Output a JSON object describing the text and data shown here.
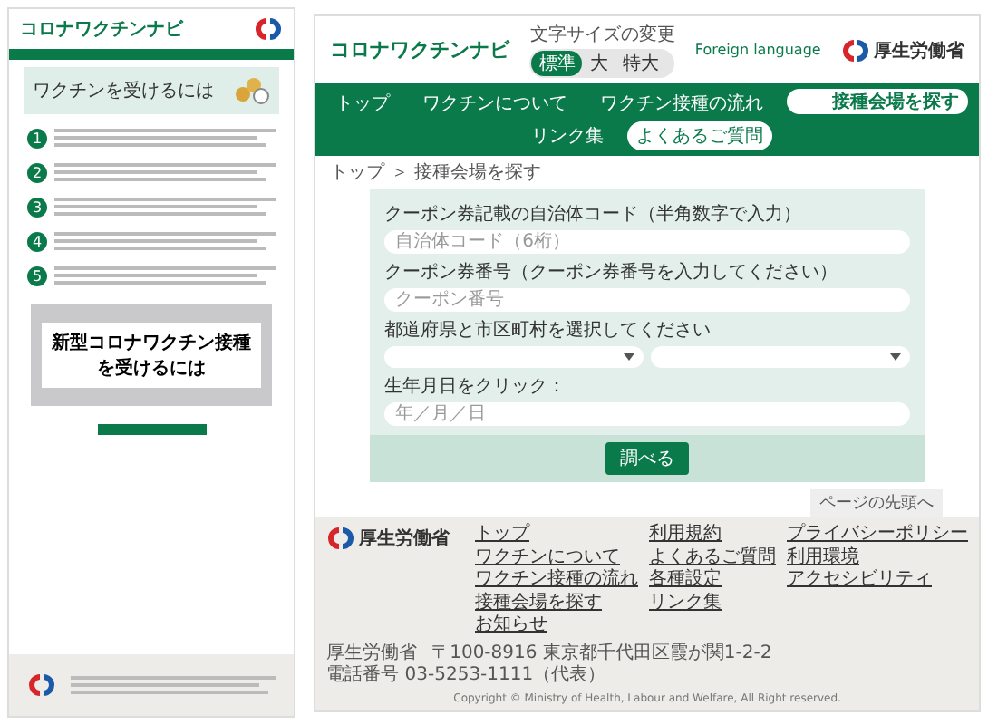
{
  "left_page": {
    "logo": "コロナワクチンナビ",
    "hero_title": "ワクチンを受けるには",
    "steps": [
      {
        "number": "1"
      },
      {
        "number": "2"
      },
      {
        "number": "3"
      },
      {
        "number": "4"
      },
      {
        "number": "5"
      }
    ],
    "video": {
      "caption": "新型コロナワクチン接種を受けるには"
    }
  },
  "right_page": {
    "header": {
      "logo": "コロナワクチンナビ",
      "font_size_label": "文字サイズの変更",
      "font_sizes": [
        {
          "label": "標準",
          "selected": true
        },
        {
          "label": "大",
          "selected": false
        },
        {
          "label": "特大",
          "selected": false
        }
      ],
      "language": "Foreign language",
      "ministry": "厚生労働省"
    },
    "nav": [
      {
        "label": "トップ",
        "kind": "link",
        "selected": false
      },
      {
        "label": "ワクチンについて",
        "kind": "link",
        "selected": false
      },
      {
        "label": "ワクチン接種の流れ",
        "kind": "link",
        "selected": false
      },
      {
        "label": "接種会場を探す",
        "kind": "link",
        "selected": true
      },
      {
        "label": "リンク集",
        "kind": "link",
        "selected": false
      },
      {
        "label": "よくあるご質問",
        "kind": "button",
        "selected": false
      }
    ],
    "breadcrumb": "トップ ＞ 接種会場を探す",
    "form": {
      "fields": [
        {
          "kind": "text",
          "label": "クーポン券記載の自治体コード（半角数字で入力）",
          "placeholder": "自治体コード（6桁）"
        },
        {
          "kind": "text",
          "label": "クーポン券番号（クーポン券番号を入力してください）",
          "placeholder": "クーポン番号"
        },
        {
          "kind": "select",
          "label": "都道府県と市区町村を選択してください"
        },
        {
          "kind": "text",
          "label": "生年月日をクリック：",
          "placeholder": "年／月／日"
        }
      ],
      "submit": "調べる"
    },
    "page_top": "ページの先頭へ",
    "footer": {
      "ministry": "厚生労働省",
      "address": [
        "厚生労働省",
        "〒100-8916 東京都千代田区霞が関1-2-2",
        "電話番号 03-5253-1111（代表）"
      ],
      "link_columns": [
        [
          "トップ",
          "ワクチンについて",
          "ワクチン接種の流れ",
          "接種会場を探す",
          "お知らせ"
        ],
        [
          "利用規約",
          "よくあるご質問",
          "各種設定",
          "リンク集"
        ],
        [
          "プライバシーポリシー",
          "利用環境",
          "アクセシビリティ"
        ]
      ],
      "copyright": "Copyright © Ministry of Health, Labour and Welfare, All Right reserved."
    }
  }
}
